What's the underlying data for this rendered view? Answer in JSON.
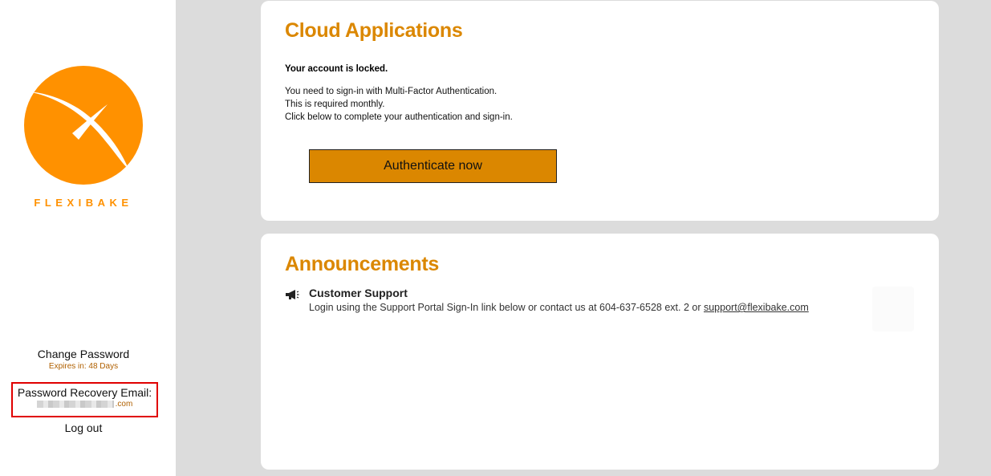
{
  "brand": {
    "name": "FLEXIBAKE",
    "accent": "#ff9100",
    "heading_color": "#db8700",
    "button_color": "#db8700"
  },
  "sidebar": {
    "change_password": "Change Password",
    "expires": "Expires in: 48 Days",
    "recovery_label": "Password Recovery Email:",
    "recovery_email_suffix": ".com",
    "logout": "Log out"
  },
  "cloud": {
    "title": "Cloud Applications",
    "locked": "Your account is locked.",
    "line1": "You need to sign-in with Multi-Factor Authentication.",
    "line2": "This is required monthly.",
    "line3": "Click below to complete your authentication and sign-in.",
    "button": "Authenticate now"
  },
  "announcements": {
    "title": "Announcements",
    "item_title": "Customer Support",
    "item_text": "Login using the Support Portal Sign-In link below or contact us at 604-637-6528 ext. 2 or ",
    "item_link": "support@flexibake.com",
    "icon": "megaphone-icon"
  }
}
